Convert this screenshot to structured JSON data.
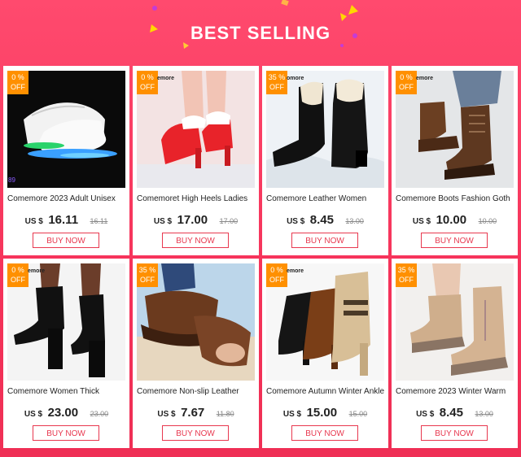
{
  "banner": {
    "title": "BEST SELLING"
  },
  "colors": {
    "banner_bg": "#f5335a",
    "accent": "#e8384f",
    "badge": "#ff9000"
  },
  "products": [
    {
      "discount": "0 %",
      "off": "OFF",
      "brand_stamp": "",
      "index_label": "89",
      "name": "Comemore 2023 Adult Unisex",
      "currency": "US $",
      "price": "16.11",
      "old_price": "16.11",
      "button": "BUY NOW"
    },
    {
      "discount": "0 %",
      "off": "OFF",
      "brand_stamp": "emore",
      "index_label": "",
      "name": "Comemoret High Heels Ladies",
      "currency": "US $",
      "price": "17.00",
      "old_price": "17.00",
      "button": "BUY NOW"
    },
    {
      "discount": "35 %",
      "off": "OFF",
      "brand_stamp": "omore",
      "index_label": "",
      "name": "Comemore Leather Women",
      "currency": "US $",
      "price": "8.45",
      "old_price": "13.00",
      "button": "BUY NOW"
    },
    {
      "discount": "0 %",
      "off": "OFF",
      "brand_stamp": "emore",
      "index_label": "",
      "name": "Comemore Boots Fashion Goth",
      "currency": "US $",
      "price": "10.00",
      "old_price": "10.00",
      "button": "BUY NOW"
    },
    {
      "discount": "0 %",
      "off": "OFF",
      "brand_stamp": "emore",
      "index_label": "",
      "name": "Comemore Women Thick",
      "currency": "US $",
      "price": "23.00",
      "old_price": "23.00",
      "button": "BUY NOW"
    },
    {
      "discount": "35 %",
      "off": "OFF",
      "brand_stamp": "",
      "index_label": "",
      "name": "Comemore Non-slip Leather",
      "currency": "US $",
      "price": "7.67",
      "old_price": "11.80",
      "button": "BUY NOW"
    },
    {
      "discount": "0 %",
      "off": "OFF",
      "brand_stamp": "emore",
      "index_label": "",
      "name": "Comemore Autumn Winter Ankle",
      "currency": "US $",
      "price": "15.00",
      "old_price": "15.00",
      "button": "BUY NOW"
    },
    {
      "discount": "35 %",
      "off": "OFF",
      "brand_stamp": "",
      "index_label": "",
      "name": "Comemore 2023 Winter Warm",
      "currency": "US $",
      "price": "8.45",
      "old_price": "13.00",
      "button": "BUY NOW"
    }
  ]
}
